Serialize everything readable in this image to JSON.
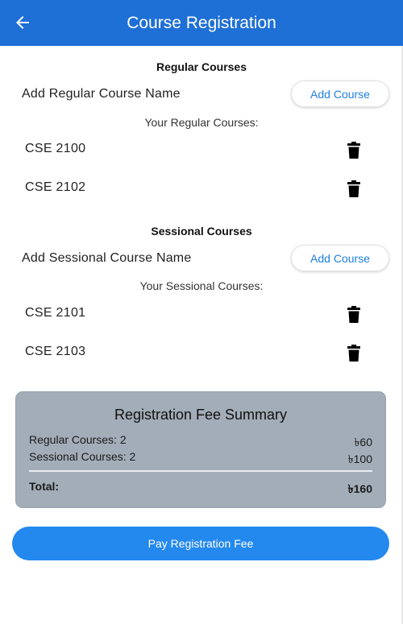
{
  "appbar": {
    "title": "Course Registration",
    "back_icon": "arrow-left-icon"
  },
  "regular": {
    "section_title": "Regular Courses",
    "add_label": "Add Regular Course Name",
    "add_button": "Add Course",
    "list_title": "Your Regular Courses:",
    "courses": [
      "CSE 2100",
      "CSE 2102"
    ]
  },
  "sessional": {
    "section_title": "Sessional Courses",
    "add_label": "Add Sessional Course Name",
    "add_button": "Add Course",
    "list_title": "Your Sessional Courses:",
    "courses": [
      "CSE 2101",
      "CSE 2103"
    ]
  },
  "summary": {
    "title": "Registration Fee Summary",
    "regular_label": "Regular Courses: 2",
    "regular_fee": "৳60",
    "sessional_label": "Sessional Courses: 2",
    "sessional_fee": "৳100",
    "total_label": "Total:",
    "total_fee": "৳160"
  },
  "pay_button": "Pay Registration Fee",
  "colors": {
    "primary": "#1e6fd6",
    "button_blue": "#2489ee",
    "summary_bg": "#a2adb8",
    "link_blue": "#1e7fe0"
  }
}
